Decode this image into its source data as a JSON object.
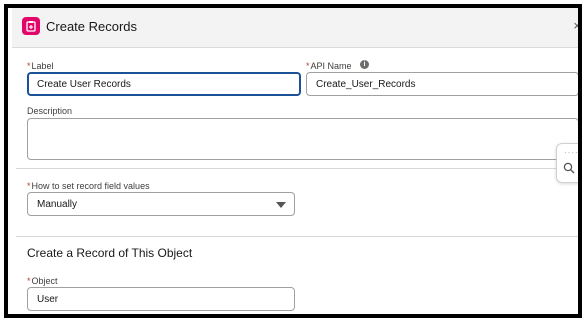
{
  "header": {
    "title": "Create Records",
    "close_glyph": "×"
  },
  "fields": {
    "label": {
      "label": "Label",
      "required": "*",
      "value": "Create User Records"
    },
    "api_name": {
      "label": "API Name",
      "required": "*",
      "value": "Create_User_Records",
      "info_glyph": "i"
    },
    "description": {
      "label": "Description",
      "value": ""
    },
    "how_to_set": {
      "label": "How to set record field values",
      "required": "*",
      "value": "Manually"
    },
    "object": {
      "label": "Object",
      "required": "*",
      "value": "User"
    }
  },
  "section": {
    "title": "Create a Record of This Object"
  },
  "side_panel": {
    "dots": "····"
  },
  "colors": {
    "accent": "#e3066a",
    "focus_border": "#1b5297",
    "required": "#c23934"
  }
}
